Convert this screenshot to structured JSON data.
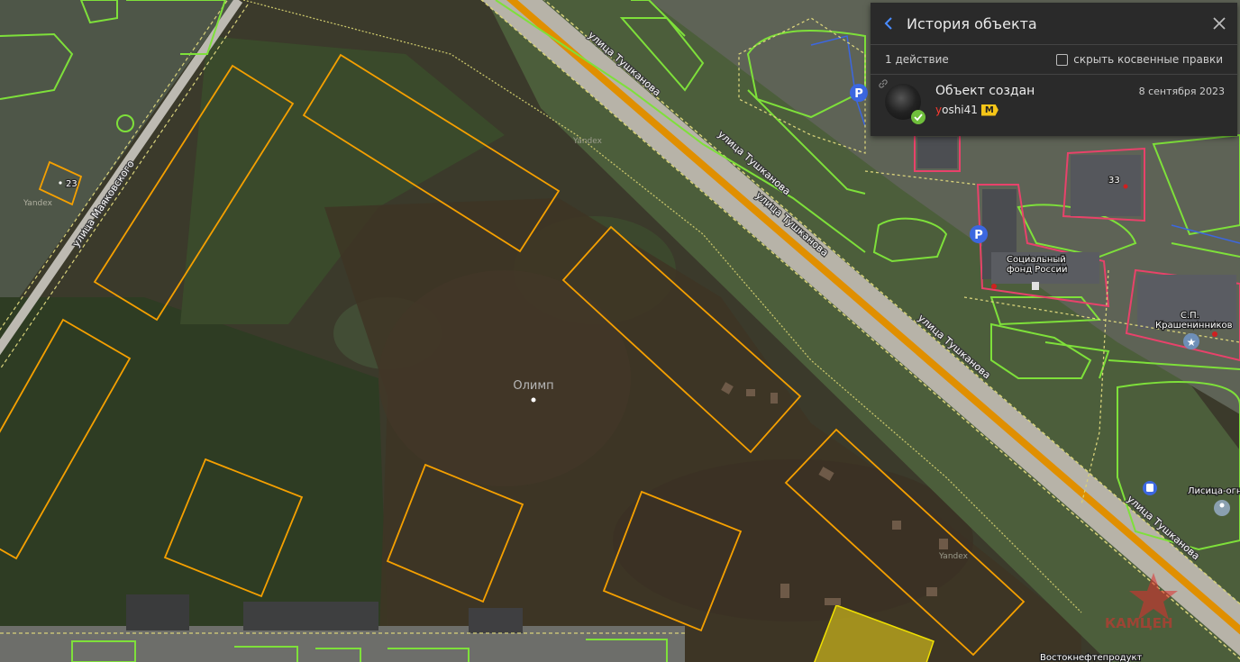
{
  "map": {
    "object_name": "Олимп",
    "watermarks": [
      "Yandex",
      "Yandex",
      "Yandex"
    ],
    "street_labels": [
      {
        "text": "улица Тушканова"
      },
      {
        "text": "улица Тушканова"
      },
      {
        "text": "улица Тушканова"
      },
      {
        "text": "улица Тушканова"
      },
      {
        "text": "улица Тушканова"
      },
      {
        "text": "улица Маяковского"
      }
    ],
    "house_numbers": [
      "23",
      "33"
    ],
    "poi_labels": {
      "social_fund_line1": "Социальный",
      "social_fund_line2": "фонд России",
      "sp_line1": "С.П.",
      "sp_line2": "Крашенинников",
      "lisitsa": "Лисица-огн",
      "vostok": "Востокнефтепродукт"
    },
    "logo_watermark": "КАМЦЕН"
  },
  "panel": {
    "title": "История объекта",
    "actions_count": "1 действие",
    "hide_indirect_label": "скрыть косвенные правки",
    "entry": {
      "title": "Объект создан",
      "date": "8 сентября 2023",
      "user_first_letter": "y",
      "user_rest": "oshi41",
      "badge": "M"
    }
  },
  "colors": {
    "building_outline": "#f5a000",
    "selected_fill": "#d8c21a",
    "road": "#e08f00",
    "green_area": "#7ee03a",
    "parking": "#3c67e0",
    "residential_outline": "#e8426b",
    "panel_bg": "#2a2a2a"
  }
}
